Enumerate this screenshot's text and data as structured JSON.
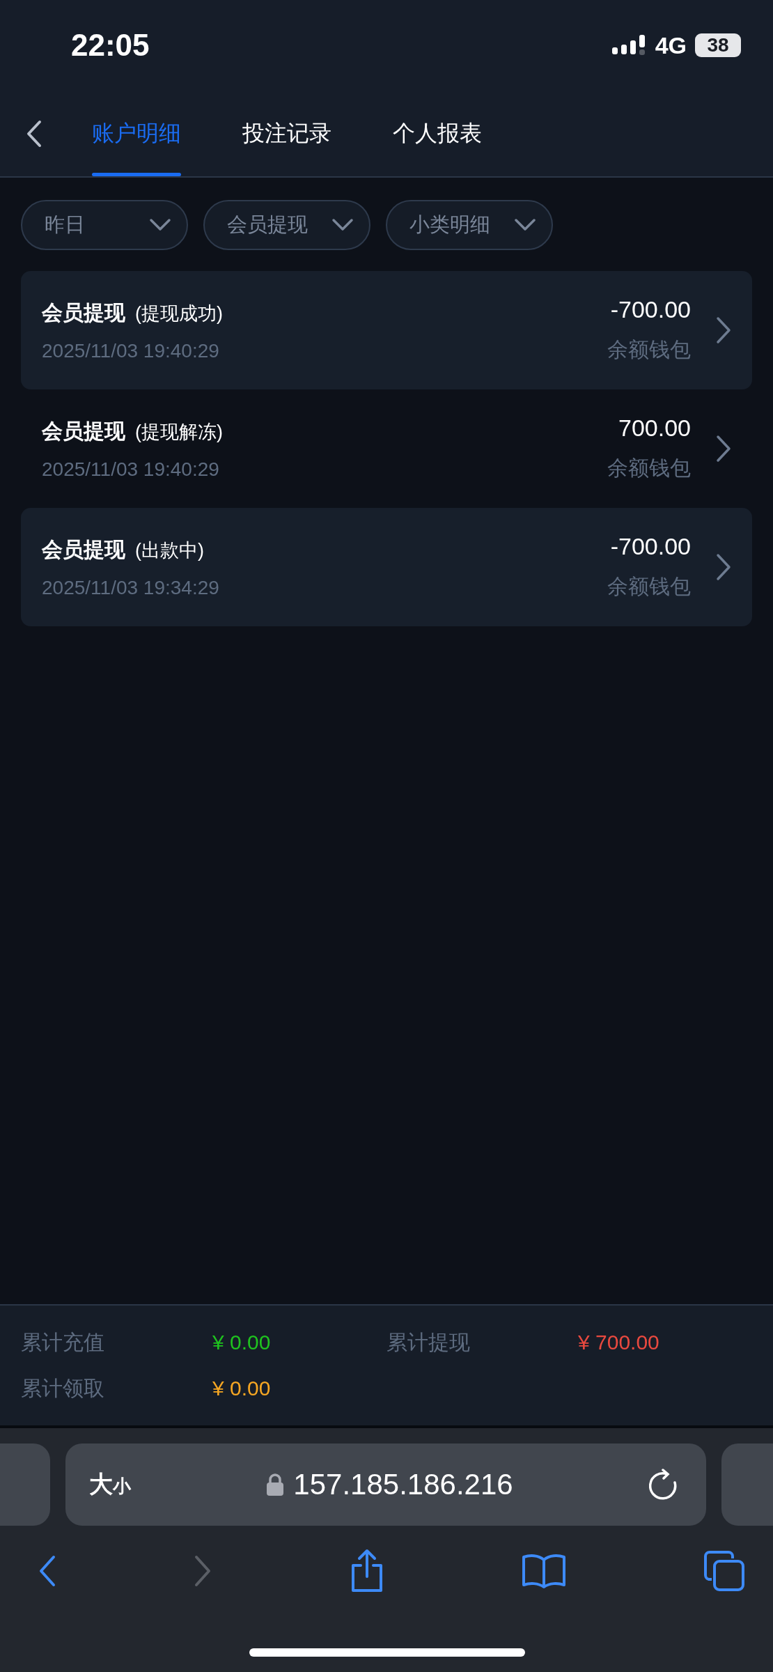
{
  "status_bar": {
    "time": "22:05",
    "network": "4G",
    "battery": "38"
  },
  "tabs": [
    {
      "label": "账户明细",
      "selected": true
    },
    {
      "label": "投注记录",
      "selected": false
    },
    {
      "label": "个人报表",
      "selected": false
    }
  ],
  "filters": [
    {
      "label": "昨日"
    },
    {
      "label": "会员提现"
    },
    {
      "label": "小类明细"
    }
  ],
  "records": [
    {
      "title": "会员提现",
      "status": "(提现成功)",
      "time": "2025/11/03 19:40:29",
      "amount": "-700.00",
      "wallet": "余额钱包"
    },
    {
      "title": "会员提现",
      "status": "(提现解冻)",
      "time": "2025/11/03 19:40:29",
      "amount": "700.00",
      "wallet": "余额钱包"
    },
    {
      "title": "会员提现",
      "status": "(出款中)",
      "time": "2025/11/03 19:34:29",
      "amount": "-700.00",
      "wallet": "余额钱包"
    }
  ],
  "summary": [
    {
      "label": "累计充值",
      "value": "¥ 0.00",
      "color": "#1fc21f"
    },
    {
      "label": "累计提现",
      "value": "¥ 700.00",
      "color": "#e8493f"
    },
    {
      "label": "累计领取",
      "value": "¥ 0.00",
      "color": "#f5a623"
    }
  ],
  "browser": {
    "text_size": "大",
    "text_size_small": "小",
    "url": "157.185.186.216",
    "toolbar": [
      {
        "kind": "back",
        "disabled": false
      },
      {
        "kind": "forward",
        "disabled": true
      },
      {
        "kind": "share",
        "disabled": false
      },
      {
        "kind": "bookmarks",
        "disabled": false
      },
      {
        "kind": "tabs",
        "disabled": false
      }
    ]
  }
}
